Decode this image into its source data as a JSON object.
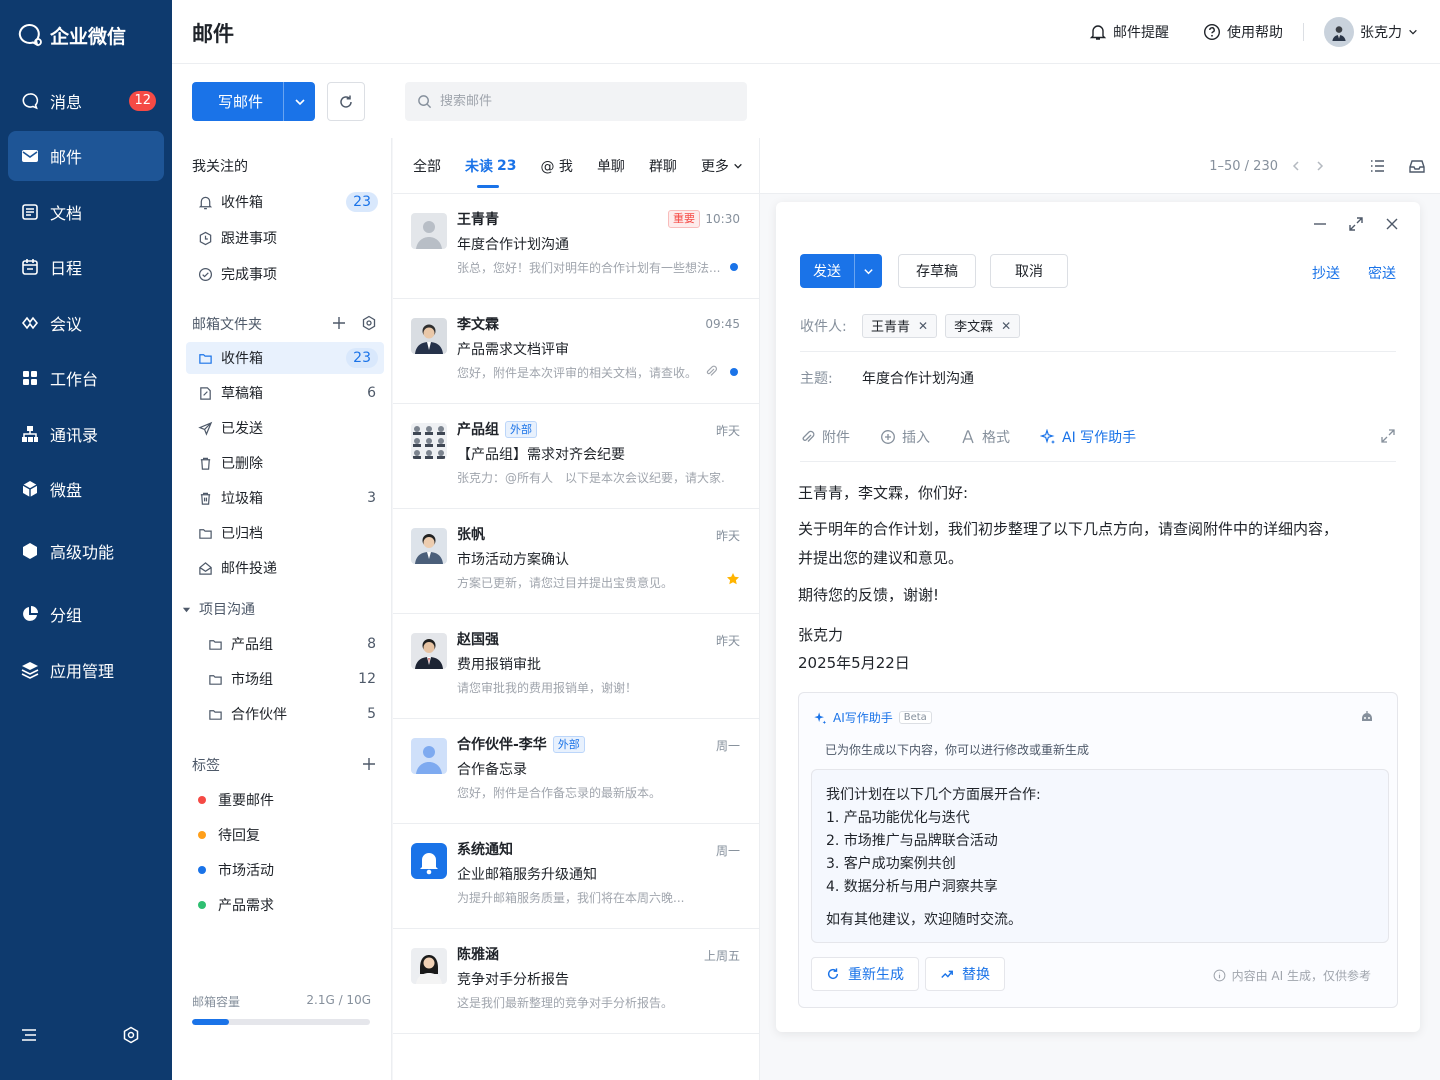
{
  "app": {
    "brand": "企业微信"
  },
  "nav": {
    "items": [
      {
        "label": "消息",
        "badge": "12"
      },
      {
        "label": "邮件"
      },
      {
        "label": "文档"
      },
      {
        "label": "日程"
      },
      {
        "label": "会议"
      },
      {
        "label": "工作台"
      },
      {
        "label": "通讯录"
      },
      {
        "label": "微盘"
      },
      {
        "label": "高级功能"
      },
      {
        "label": "分组"
      },
      {
        "label": "应用管理"
      }
    ]
  },
  "header": {
    "title": "邮件",
    "notify": "邮件提醒",
    "help": "使用帮助",
    "user": "张克力"
  },
  "toolbar": {
    "compose": "写邮件",
    "search_placeholder": "搜索邮件"
  },
  "folders": {
    "followed_title": "我关注的",
    "followed": [
      {
        "label": "收件箱",
        "count": "23"
      },
      {
        "label": "跟进事项"
      },
      {
        "label": "完成事项"
      }
    ],
    "mailbox_title": "邮箱文件夹",
    "mailbox": [
      {
        "label": "收件箱",
        "count": "23"
      },
      {
        "label": "草稿箱",
        "count": "6"
      },
      {
        "label": "已发送"
      },
      {
        "label": "已删除"
      },
      {
        "label": "垃圾箱",
        "count": "3"
      },
      {
        "label": "已归档"
      },
      {
        "label": "邮件投递"
      }
    ],
    "project_title": "项目沟通",
    "project": [
      {
        "label": "产品组",
        "count": "8"
      },
      {
        "label": "市场组",
        "count": "12"
      },
      {
        "label": "合作伙伴",
        "count": "5"
      }
    ],
    "tags_title": "标签",
    "tags": [
      {
        "label": "重要邮件",
        "color": "#f54a45"
      },
      {
        "label": "待回复",
        "color": "#ff9f1a"
      },
      {
        "label": "市场活动",
        "color": "#1a73e8"
      },
      {
        "label": "产品需求",
        "color": "#2fbf71"
      }
    ],
    "storage_label": "邮箱容量",
    "storage_value": "2.1G / 10G",
    "storage_fraction": 0.21
  },
  "list": {
    "tabs": [
      "全部",
      "未读",
      "@ 我",
      "单聊",
      "群聊",
      "更多"
    ],
    "unread_count": "23",
    "pager": "1–50 / 230",
    "mails": [
      {
        "sender": "王青青",
        "tag": "重要",
        "time": "10:30",
        "subject": "年度合作计划沟通",
        "preview": "张总，您好！我们对明年的合作计划有一些想法...",
        "unread": true
      },
      {
        "sender": "李文霖",
        "time": "09:45",
        "subject": "产品需求文档评审",
        "preview": "您好，附件是本次评审的相关文档，请查收。",
        "unread": true,
        "attachment": true
      },
      {
        "sender": "产品组",
        "badge": "外部",
        "time": "昨天",
        "subject": "【产品组】需求对齐会纪要",
        "preview": "张克力：@所有人　以下是本次会议纪要，请大家..."
      },
      {
        "sender": "张帆",
        "time": "昨天",
        "subject": "市场活动方案确认",
        "preview": "方案已更新，请您过目并提出宝贵意见。",
        "starred": true
      },
      {
        "sender": "赵国强",
        "time": "昨天",
        "subject": "费用报销审批",
        "preview": "请您审批我的费用报销单，谢谢！"
      },
      {
        "sender": "合作伙伴-李华",
        "badge": "外部",
        "time": "周一",
        "subject": "合作备忘录",
        "preview": "您好，附件是合作备忘录的最新版本。"
      },
      {
        "sender": "系统通知",
        "time": "周一",
        "subject": "企业邮箱服务升级通知",
        "preview": "为提升邮箱服务质量，我们将在本周六晚..."
      },
      {
        "sender": "陈雅涵",
        "time": "上周五",
        "subject": "竞争对手分析报告",
        "preview": "这是我们最新整理的竞争对手分析报告。"
      }
    ]
  },
  "composer": {
    "send": "发送",
    "draft": "存草稿",
    "cancel": "取消",
    "cc": "抄送",
    "bcc": "密送",
    "to_label": "收件人:",
    "recipients": [
      "王青青",
      "李文霖"
    ],
    "subject_label": "主题:",
    "subject": "年度合作计划沟通",
    "tools": {
      "attach": "附件",
      "insert": "插入",
      "format": "格式",
      "ai": "AI 写作助手"
    },
    "body": {
      "greeting": "王青青，李文霖，你们好:",
      "p1a": "关于明年的合作计划，我们初步整理了以下几点方向，请查阅附件中的详细内容，",
      "p1b": "并提出您的建议和意见。",
      "p2": "期待您的反馈，谢谢!",
      "sign": "张克力",
      "date": "2025年5月22日"
    },
    "ai": {
      "title": "AI写作助手",
      "beta": "Beta",
      "subtitle": "已为你生成以下内容，你可以进行修改或重新生成",
      "intro": "我们计划在以下几个方面展开合作:",
      "points": [
        "1. 产品功能优化与迭代",
        "2. 市场推广与品牌联合活动",
        "3. 客户成功案例共创",
        "4. 数据分析与用户洞察共享"
      ],
      "closing": "如有其他建议，欢迎随时交流。",
      "regenerate": "重新生成",
      "replace": "替换",
      "note": "内容由 AI 生成，仅供参考"
    }
  }
}
